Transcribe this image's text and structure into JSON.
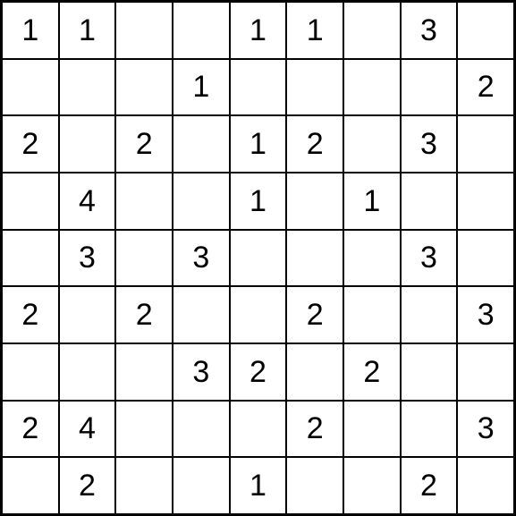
{
  "puzzle": {
    "name": "number-grid-puzzle",
    "rows": 9,
    "cols": 9,
    "cells": [
      [
        "1",
        "1",
        "",
        "",
        "1",
        "1",
        "",
        "3",
        ""
      ],
      [
        "",
        "",
        "",
        "1",
        "",
        "",
        "",
        "",
        "2"
      ],
      [
        "2",
        "",
        "2",
        "",
        "1",
        "2",
        "",
        "3",
        ""
      ],
      [
        "",
        "4",
        "",
        "",
        "1",
        "",
        "1",
        "",
        ""
      ],
      [
        "",
        "3",
        "",
        "3",
        "",
        "",
        "",
        "3",
        ""
      ],
      [
        "2",
        "",
        "2",
        "",
        "",
        "2",
        "",
        "",
        "3"
      ],
      [
        "",
        "",
        "",
        "3",
        "2",
        "",
        "2",
        "",
        ""
      ],
      [
        "2",
        "4",
        "",
        "",
        "",
        "2",
        "",
        "",
        "3"
      ],
      [
        "",
        "2",
        "",
        "",
        "1",
        "",
        "",
        "2",
        ""
      ]
    ]
  },
  "chart_data": {
    "type": "table",
    "title": "",
    "rows": 9,
    "cols": 9,
    "values": [
      [
        1,
        1,
        null,
        null,
        1,
        1,
        null,
        3,
        null
      ],
      [
        null,
        null,
        null,
        1,
        null,
        null,
        null,
        null,
        2
      ],
      [
        2,
        null,
        2,
        null,
        1,
        2,
        null,
        3,
        null
      ],
      [
        null,
        4,
        null,
        null,
        1,
        null,
        1,
        null,
        null
      ],
      [
        null,
        3,
        null,
        3,
        null,
        null,
        null,
        3,
        null
      ],
      [
        2,
        null,
        2,
        null,
        null,
        2,
        null,
        null,
        3
      ],
      [
        null,
        null,
        null,
        3,
        2,
        null,
        2,
        null,
        null
      ],
      [
        2,
        4,
        null,
        null,
        null,
        2,
        null,
        null,
        3
      ],
      [
        null,
        2,
        null,
        null,
        1,
        null,
        null,
        2,
        null
      ]
    ]
  }
}
